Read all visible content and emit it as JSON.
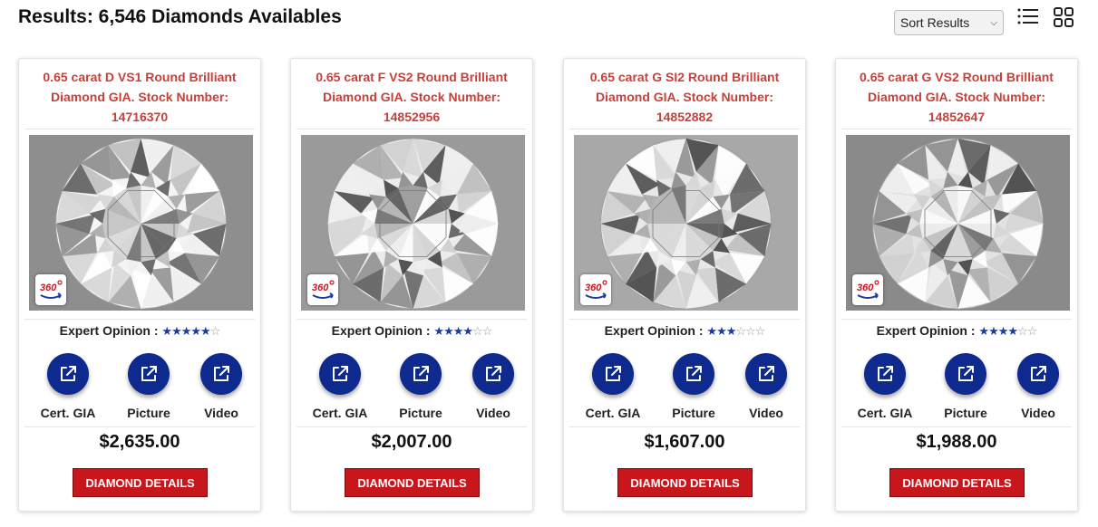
{
  "header": {
    "results_title": "Results: 6,546 Diamonds Availables",
    "sort_label": "Sort Results",
    "list_view_icon": "list-view-icon",
    "grid_view_icon": "grid-view-icon"
  },
  "labels": {
    "expert_opinion": "Expert Opinion :",
    "cert": "Cert. GIA",
    "picture": "Picture",
    "video": "Video",
    "details_button": "DIAMOND DETAILS",
    "badge_360": "360°"
  },
  "colors": {
    "title_red": "#c8403a",
    "button_red": "#c8161d",
    "circle_blue": "#0f2a8f",
    "star_blue": "#1b3c9e"
  },
  "diamonds": [
    {
      "title": "0.65 carat D VS1 Round Brilliant Diamond GIA. Stock Number: 14716370",
      "rating": 5,
      "max_rating": 6,
      "price": "$2,635.00"
    },
    {
      "title": "0.65 carat F VS2 Round Brilliant Diamond GIA. Stock Number: 14852956",
      "rating": 4,
      "max_rating": 6,
      "price": "$2,007.00"
    },
    {
      "title": "0.65 carat G SI2 Round Brilliant Diamond GIA. Stock Number: 14852882",
      "rating": 3,
      "max_rating": 6,
      "price": "$1,607.00"
    },
    {
      "title": "0.65 carat G VS2 Round Brilliant Diamond GIA. Stock Number: 14852647",
      "rating": 4,
      "max_rating": 6,
      "price": "$1,988.00"
    }
  ]
}
